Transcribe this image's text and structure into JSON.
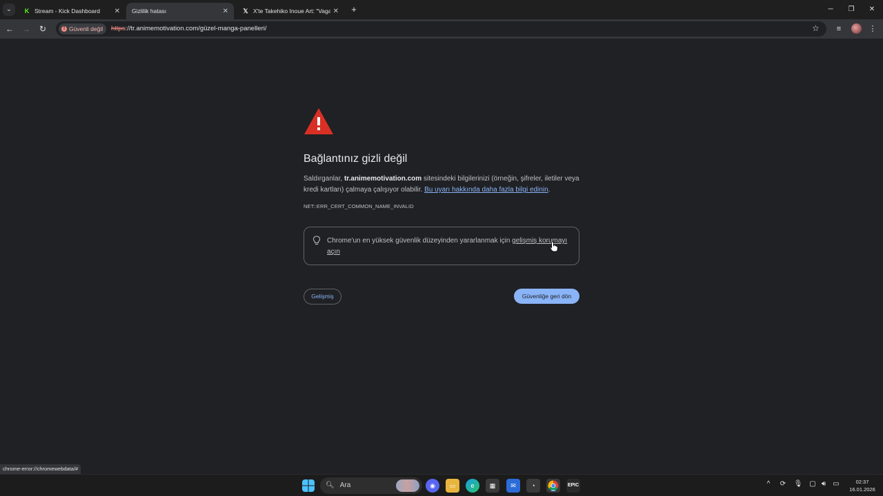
{
  "browser": {
    "tabs": [
      {
        "title": "Stream - Kick Dashboard",
        "favicon": "kick-icon",
        "active": false
      },
      {
        "title": "Gizlilik hatası",
        "favicon": "warning-icon",
        "active": true
      },
      {
        "title": "X'te Takehiko Inoue Art: \"Vagab",
        "favicon": "x-icon",
        "active": false
      }
    ],
    "security_chip": "Güvenli değil",
    "url_scheme": "https",
    "url_rest": "://tr.animemotivation.com/güzel-manga-panelleri/",
    "status_url": "chrome-error://chromewebdata/#"
  },
  "interstitial": {
    "heading": "Bağlantınız gizli değil",
    "para_prefix": "Saldırganlar, ",
    "para_domain": "tr.animemotivation.com",
    "para_middle": " sitesindeki bilgilerinizi (örneğin, şifreler, iletiler veya kredi kartları) çalmaya çalışıyor olabilir. ",
    "learn_more_link": "Bu uyarı hakkında daha fazla bilgi edinin",
    "para_suffix": ".",
    "error_code": "NET::ERR_CERT_COMMON_NAME_INVALID",
    "enhanced_prefix": "Chrome'un en yüksek güvenlik düzeyinden yararlanmak için ",
    "enhanced_link": "gelişmiş korumayı açın",
    "advanced_button": "Gelişmiş",
    "back_button": "Güvenliğe geri dön"
  },
  "taskbar": {
    "search_placeholder": "Ara",
    "time": "02:37",
    "date": "16.01.2026"
  },
  "colors": {
    "accent": "#8ab4f8",
    "warning_red": "#d93025",
    "page_bg": "#202124"
  }
}
